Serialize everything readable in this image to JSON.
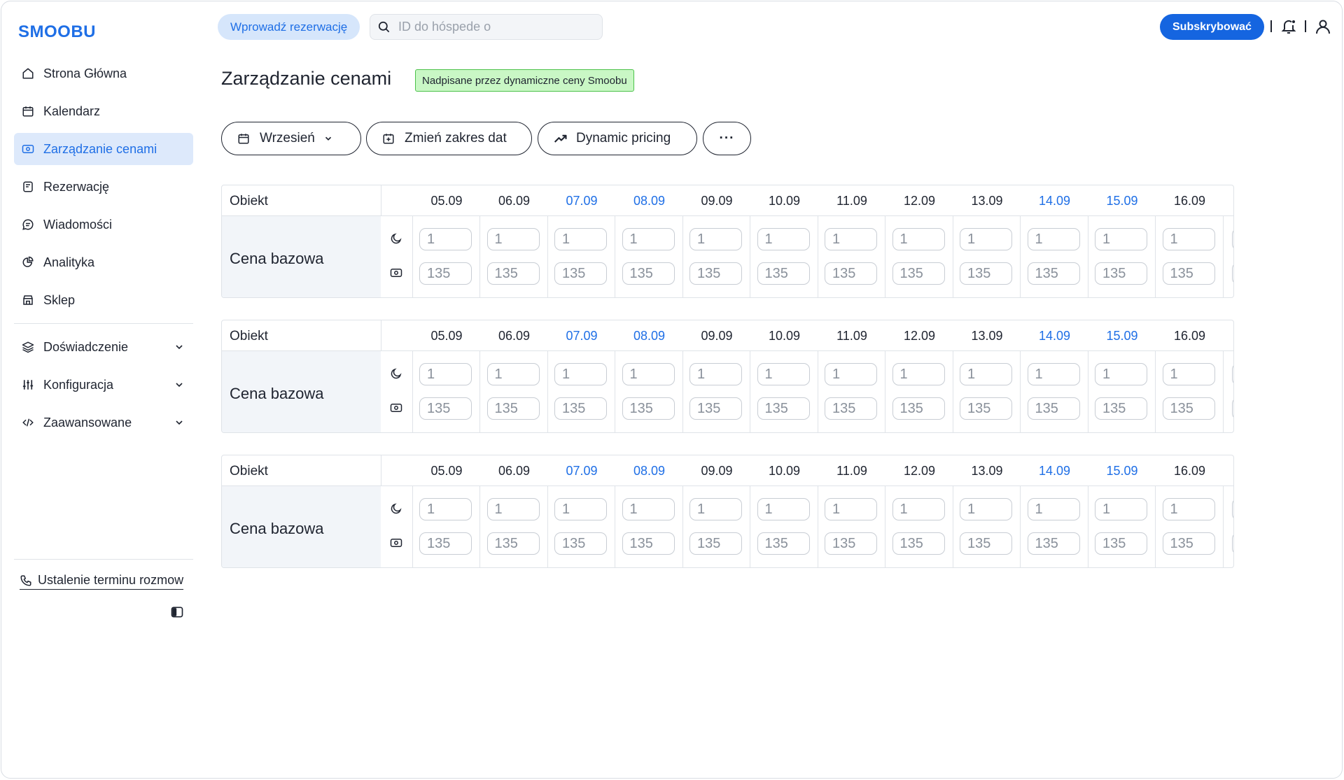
{
  "app": {
    "logo": "SMOOBU"
  },
  "sidebar": {
    "items": [
      {
        "label": "Strona Główna",
        "icon": "home-icon",
        "active": false
      },
      {
        "label": "Kalendarz",
        "icon": "calendar-icon",
        "active": false
      },
      {
        "label": "Zarządzanie cenami",
        "icon": "price-icon",
        "active": true
      },
      {
        "label": "Rezerwację",
        "icon": "booking-icon",
        "active": false
      },
      {
        "label": "Wiadomości",
        "icon": "message-icon",
        "active": false
      },
      {
        "label": "Analityka",
        "icon": "analytics-icon",
        "active": false
      },
      {
        "label": "Sklep",
        "icon": "store-icon",
        "active": false
      }
    ],
    "expandables": [
      {
        "label": "Doświadczenie",
        "icon": "layers-icon"
      },
      {
        "label": "Konfiguracja",
        "icon": "sliders-icon"
      },
      {
        "label": "Zaawansowane",
        "icon": "code-icon"
      }
    ],
    "call_link": "Ustalenie terminu rozmow"
  },
  "topbar": {
    "enter_reservation": "Wprowadź rezerwację",
    "search_placeholder": "ID do hóspede o",
    "subscribe": "Subskrybować"
  },
  "page": {
    "title": "Zarządzanie cenami",
    "badge": "Nadpisane przez dynamiczne ceny Smoobu"
  },
  "toolbar": {
    "month": "Wrzesień",
    "change_range": "Zmień zakres dat",
    "dynamic_pricing": "Dynamic pricing",
    "more": "···"
  },
  "colors": {
    "accent": "#1f6fe6",
    "badge_bg": "#c9f7c5",
    "badge_border": "#4cc24a"
  },
  "price_tables": [
    {
      "header_label": "Obiekt",
      "row_label": "Cena bazowa",
      "dates": [
        {
          "label": "05.09",
          "weekend": false
        },
        {
          "label": "06.09",
          "weekend": false
        },
        {
          "label": "07.09",
          "weekend": true
        },
        {
          "label": "08.09",
          "weekend": true
        },
        {
          "label": "09.09",
          "weekend": false
        },
        {
          "label": "10.09",
          "weekend": false
        },
        {
          "label": "11.09",
          "weekend": false
        },
        {
          "label": "12.09",
          "weekend": false
        },
        {
          "label": "13.09",
          "weekend": false
        },
        {
          "label": "14.09",
          "weekend": true
        },
        {
          "label": "15.09",
          "weekend": true
        },
        {
          "label": "16.09",
          "weekend": false
        }
      ],
      "min_nights": [
        "1",
        "1",
        "1",
        "1",
        "1",
        "1",
        "1",
        "1",
        "1",
        "1",
        "1",
        "1"
      ],
      "prices": [
        "135",
        "135",
        "135",
        "135",
        "135",
        "135",
        "135",
        "135",
        "135",
        "135",
        "135",
        "135"
      ]
    },
    {
      "header_label": "Obiekt",
      "row_label": "Cena bazowa",
      "dates": [
        {
          "label": "05.09",
          "weekend": false
        },
        {
          "label": "06.09",
          "weekend": false
        },
        {
          "label": "07.09",
          "weekend": true
        },
        {
          "label": "08.09",
          "weekend": true
        },
        {
          "label": "09.09",
          "weekend": false
        },
        {
          "label": "10.09",
          "weekend": false
        },
        {
          "label": "11.09",
          "weekend": false
        },
        {
          "label": "12.09",
          "weekend": false
        },
        {
          "label": "13.09",
          "weekend": false
        },
        {
          "label": "14.09",
          "weekend": true
        },
        {
          "label": "15.09",
          "weekend": true
        },
        {
          "label": "16.09",
          "weekend": false
        }
      ],
      "min_nights": [
        "1",
        "1",
        "1",
        "1",
        "1",
        "1",
        "1",
        "1",
        "1",
        "1",
        "1",
        "1"
      ],
      "prices": [
        "135",
        "135",
        "135",
        "135",
        "135",
        "135",
        "135",
        "135",
        "135",
        "135",
        "135",
        "135"
      ]
    },
    {
      "header_label": "Obiekt",
      "row_label": "Cena bazowa",
      "dates": [
        {
          "label": "05.09",
          "weekend": false
        },
        {
          "label": "06.09",
          "weekend": false
        },
        {
          "label": "07.09",
          "weekend": true
        },
        {
          "label": "08.09",
          "weekend": true
        },
        {
          "label": "09.09",
          "weekend": false
        },
        {
          "label": "10.09",
          "weekend": false
        },
        {
          "label": "11.09",
          "weekend": false
        },
        {
          "label": "12.09",
          "weekend": false
        },
        {
          "label": "13.09",
          "weekend": false
        },
        {
          "label": "14.09",
          "weekend": true
        },
        {
          "label": "15.09",
          "weekend": true
        },
        {
          "label": "16.09",
          "weekend": false
        }
      ],
      "min_nights": [
        "1",
        "1",
        "1",
        "1",
        "1",
        "1",
        "1",
        "1",
        "1",
        "1",
        "1",
        "1"
      ],
      "prices": [
        "135",
        "135",
        "135",
        "135",
        "135",
        "135",
        "135",
        "135",
        "135",
        "135",
        "135",
        "135"
      ]
    }
  ]
}
